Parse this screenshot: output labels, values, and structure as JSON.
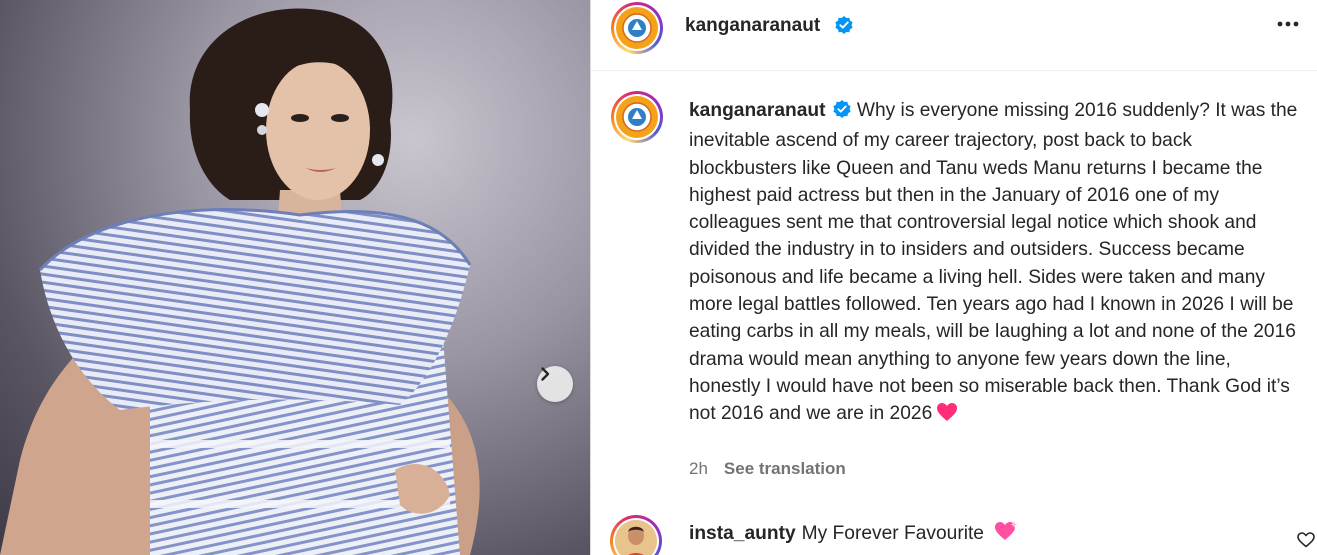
{
  "post": {
    "username": "kanganaranaut",
    "verified": true,
    "more_icon": "more-horizontal-icon",
    "next_icon": "chevron-right-icon"
  },
  "caption": {
    "username": "kanganaranaut",
    "text": "Why is everyone missing 2016 suddenly? It was the inevitable ascend of my career trajectory, post back to back blockbusters like Queen and Tanu weds Manu returns I became the highest paid actress but then in the January of 2016 one of my colleagues sent me that controversial legal notice which shook and divided the industry in to insiders and outsiders. Success became poisonous and life became a living hell. Sides were taken and many more legal battles followed. Ten years ago had I known in 2026 I will be eating carbs in all my meals, will be laughing a lot and none of the 2016 drama would mean anything to anyone few years down the line, honestly I would have not been so miserable back then. Thank God it’s not 2016 and we are in 2026",
    "emoji": "pink-heart-icon",
    "time": "2h",
    "see_translation": "See translation"
  },
  "comment": {
    "username": "insta_aunty",
    "text": "My Forever Favourite",
    "emoji": "sparkling-heart-icon",
    "like_icon": "heart-outline-icon"
  },
  "colors": {
    "text": "#262626",
    "muted": "#737373",
    "verified": "#0095f6",
    "heart": "#ff2d7a"
  }
}
